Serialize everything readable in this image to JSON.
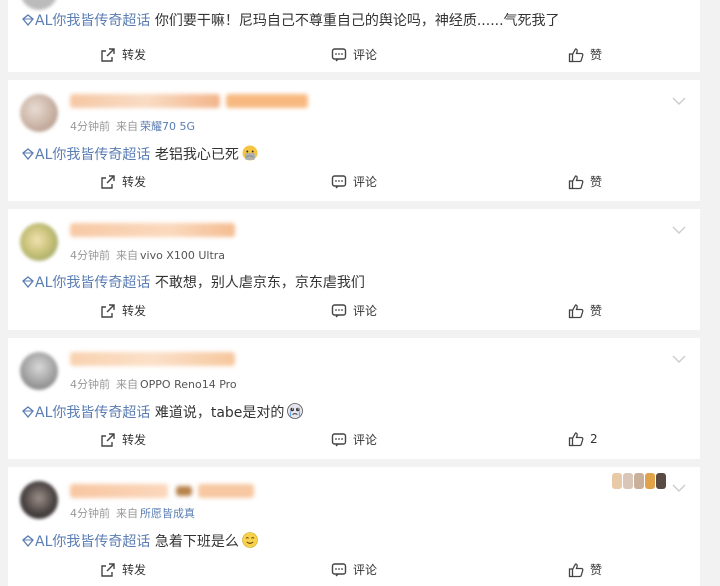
{
  "posts": [
    {
      "topic": "AL你我皆传奇超话",
      "text": "你们要干嘛！尼玛自己不尊重自己的舆论吗，神经质......气死我了",
      "actions": {
        "repost": "转发",
        "comment": "评论",
        "like": "赞"
      }
    },
    {
      "time": "4分钟前",
      "from_label": "来自",
      "source": "荣耀70 5G",
      "topic": "AL你我皆传奇超话",
      "text": "老铝我心已死",
      "emoji": "sad-emoji",
      "actions": {
        "repost": "转发",
        "comment": "评论",
        "like": "赞"
      }
    },
    {
      "time": "4分钟前",
      "from_label": "来自",
      "source": "vivo X100 Ultra",
      "topic": "AL你我皆传奇超话",
      "text": "不敢想，别人虐京东，京东虐我们",
      "actions": {
        "repost": "转发",
        "comment": "评论",
        "like": "赞"
      }
    },
    {
      "time": "4分钟前",
      "from_label": "来自",
      "source": "OPPO Reno14 Pro",
      "topic": "AL你我皆传奇超话",
      "text": "难道说，tabe是对的",
      "emoji": "crying-emoji",
      "actions": {
        "repost": "转发",
        "comment": "评论",
        "like": "2"
      }
    },
    {
      "time": "4分钟前",
      "from_label": "来自",
      "source": "所愿皆成真",
      "topic": "AL你我皆传奇超话",
      "text": "急着下班是么",
      "emoji": "smile-emoji",
      "actions": {
        "repost": "转发",
        "comment": "评论",
        "like": "赞"
      }
    }
  ],
  "colors": {
    "topic": "#5a7db3",
    "meta": "#999999",
    "background": "#f2f2f2"
  }
}
